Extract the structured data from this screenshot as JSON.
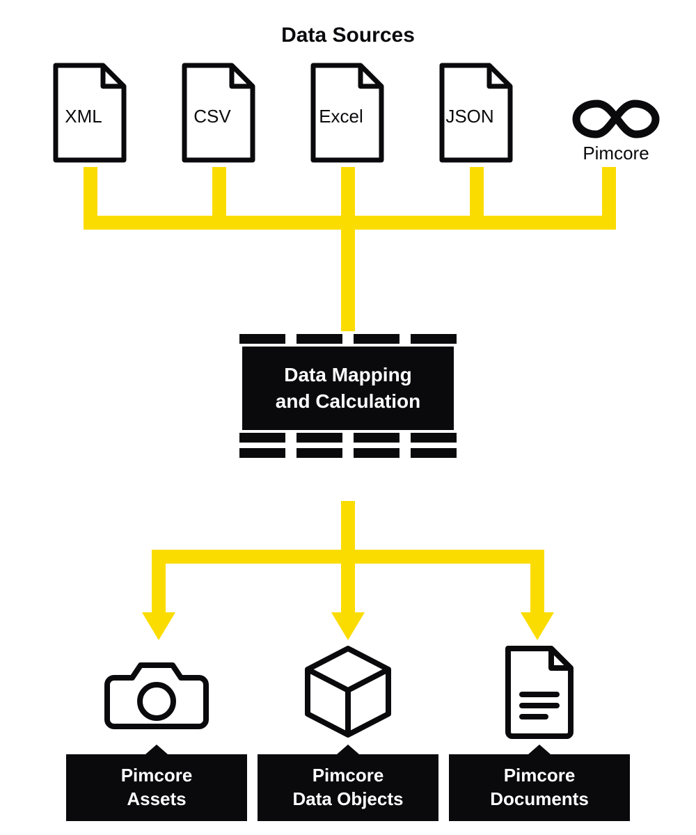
{
  "title": "Data Sources",
  "sources": {
    "xml": "XML",
    "csv": "CSV",
    "excel": "Excel",
    "json": "JSON",
    "pimcore": "Pimcore"
  },
  "center": "Data Mapping\nand Calculation",
  "targets": {
    "assets": "Pimcore\nAssets",
    "dataobjects": "Pimcore\nData Objects",
    "documents": "Pimcore\nDocuments"
  },
  "colors": {
    "flow": "#fadc00",
    "ink": "#0a0a0d"
  }
}
